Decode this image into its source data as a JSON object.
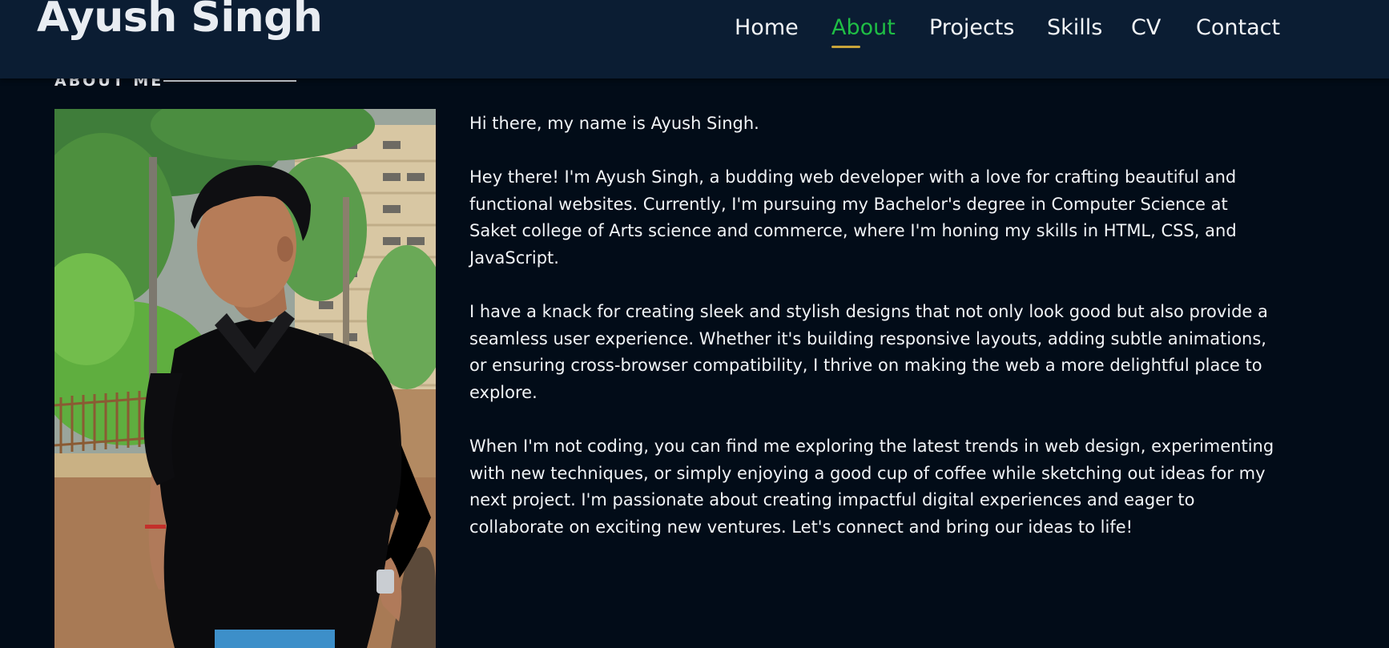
{
  "header": {
    "brand": "Ayush Singh",
    "nav": [
      {
        "label": "Home",
        "active": false
      },
      {
        "label": "About",
        "active": true
      },
      {
        "label": "Projects",
        "active": false
      },
      {
        "label": "Skills",
        "active": false
      },
      {
        "label": "CV",
        "active": false
      },
      {
        "label": "Contact",
        "active": false
      }
    ]
  },
  "about": {
    "section_label": "ABOUT ME",
    "intro": "Hi there, my name is Ayush Singh.",
    "paragraphs": [
      "Hey there! I'm Ayush Singh, a budding web developer with a love for crafting beautiful and functional websites. Currently, I'm pursuing my Bachelor's degree in Computer Science at Saket college of Arts science and commerce, where I'm honing my skills in HTML, CSS, and JavaScript.",
      "I have a knack for creating sleek and stylish designs that not only look good but also provide a seamless user experience. Whether it's building responsive layouts, adding subtle animations, or ensuring cross-browser compatibility, I thrive on making the web a more delightful place to explore.",
      "When I'm not coding, you can find me exploring the latest trends in web design, experimenting with new techniques, or simply enjoying a good cup of coffee while sketching out ideas for my next project. I'm passionate about creating impactful digital experiences and eager to collaborate on exciting new ventures. Let's connect and bring our ideas to life!"
    ]
  },
  "colors": {
    "background": "#020c18",
    "header": "#0b1d33",
    "active_nav": "#1fbe45",
    "underline": "#c8a43a"
  }
}
